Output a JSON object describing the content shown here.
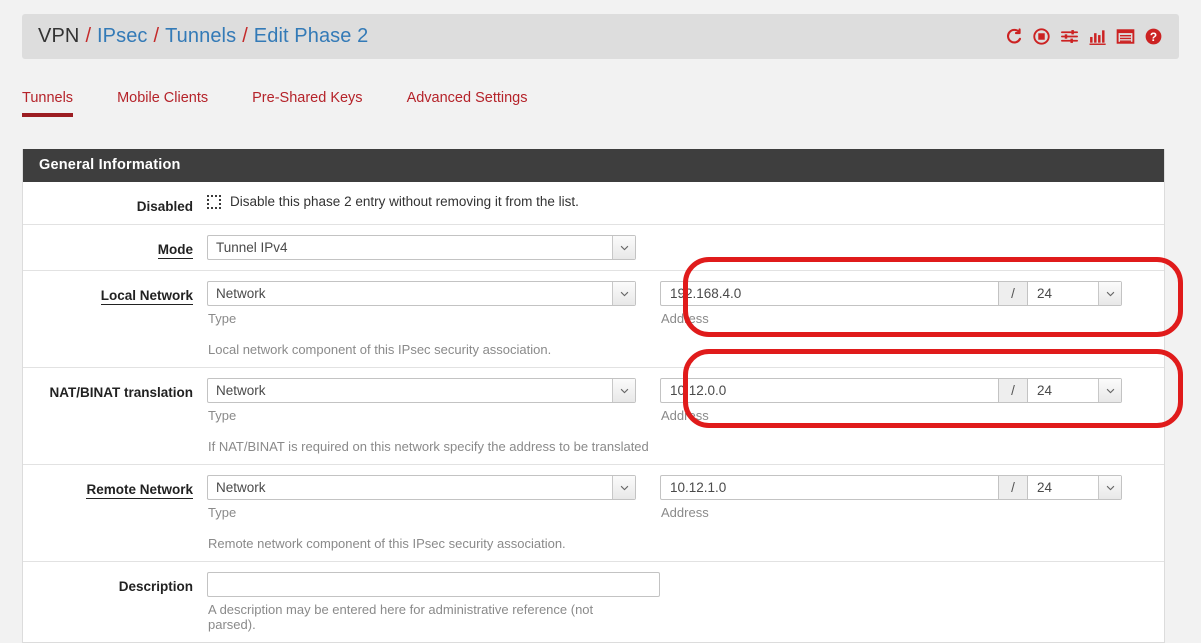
{
  "breadcrumb": {
    "items": [
      "VPN",
      "IPsec",
      "Tunnels",
      "Edit Phase 2"
    ],
    "separator": "/"
  },
  "header_icons": [
    {
      "name": "refresh-icon",
      "label": "Restart"
    },
    {
      "name": "stop-icon",
      "label": "Stop"
    },
    {
      "name": "sliders-icon",
      "label": "Settings"
    },
    {
      "name": "bar-chart-icon",
      "label": "Status"
    },
    {
      "name": "list-icon",
      "label": "Logs"
    },
    {
      "name": "help-icon",
      "label": "Help"
    }
  ],
  "tabs": [
    {
      "label": "Tunnels",
      "active": true
    },
    {
      "label": "Mobile Clients",
      "active": false
    },
    {
      "label": "Pre-Shared Keys",
      "active": false
    },
    {
      "label": "Advanced Settings",
      "active": false
    }
  ],
  "panel": {
    "title": "General Information"
  },
  "fields": {
    "disabled": {
      "label": "Disabled",
      "checked": false,
      "text": "Disable this phase 2 entry without removing it from the list."
    },
    "mode": {
      "label": "Mode",
      "value": "Tunnel IPv4"
    },
    "local_network": {
      "label": "Local Network",
      "type_value": "Network",
      "type_help": "Type",
      "address": "192.168.4.0",
      "slash": "/",
      "mask": "24",
      "address_help": "Address",
      "row_help": "Local network component of this IPsec security association."
    },
    "nat_binat": {
      "label": "NAT/BINAT translation",
      "type_value": "Network",
      "type_help": "Type",
      "address": "10.12.0.0",
      "slash": "/",
      "mask": "24",
      "address_help": "Address",
      "row_help": "If NAT/BINAT is required on this network specify the address to be translated"
    },
    "remote_network": {
      "label": "Remote Network",
      "type_value": "Network",
      "type_help": "Type",
      "address": "10.12.1.0",
      "slash": "/",
      "mask": "24",
      "address_help": "Address",
      "row_help": "Remote network component of this IPsec security association."
    },
    "description": {
      "label": "Description",
      "value": "",
      "help": "A description may be entered here for administrative reference (not parsed)."
    }
  },
  "colors": {
    "accent_red": "#cc2222",
    "link_blue": "#337ab7",
    "annotation_red": "#e01b1b",
    "panel_header": "#3e3e3e"
  }
}
